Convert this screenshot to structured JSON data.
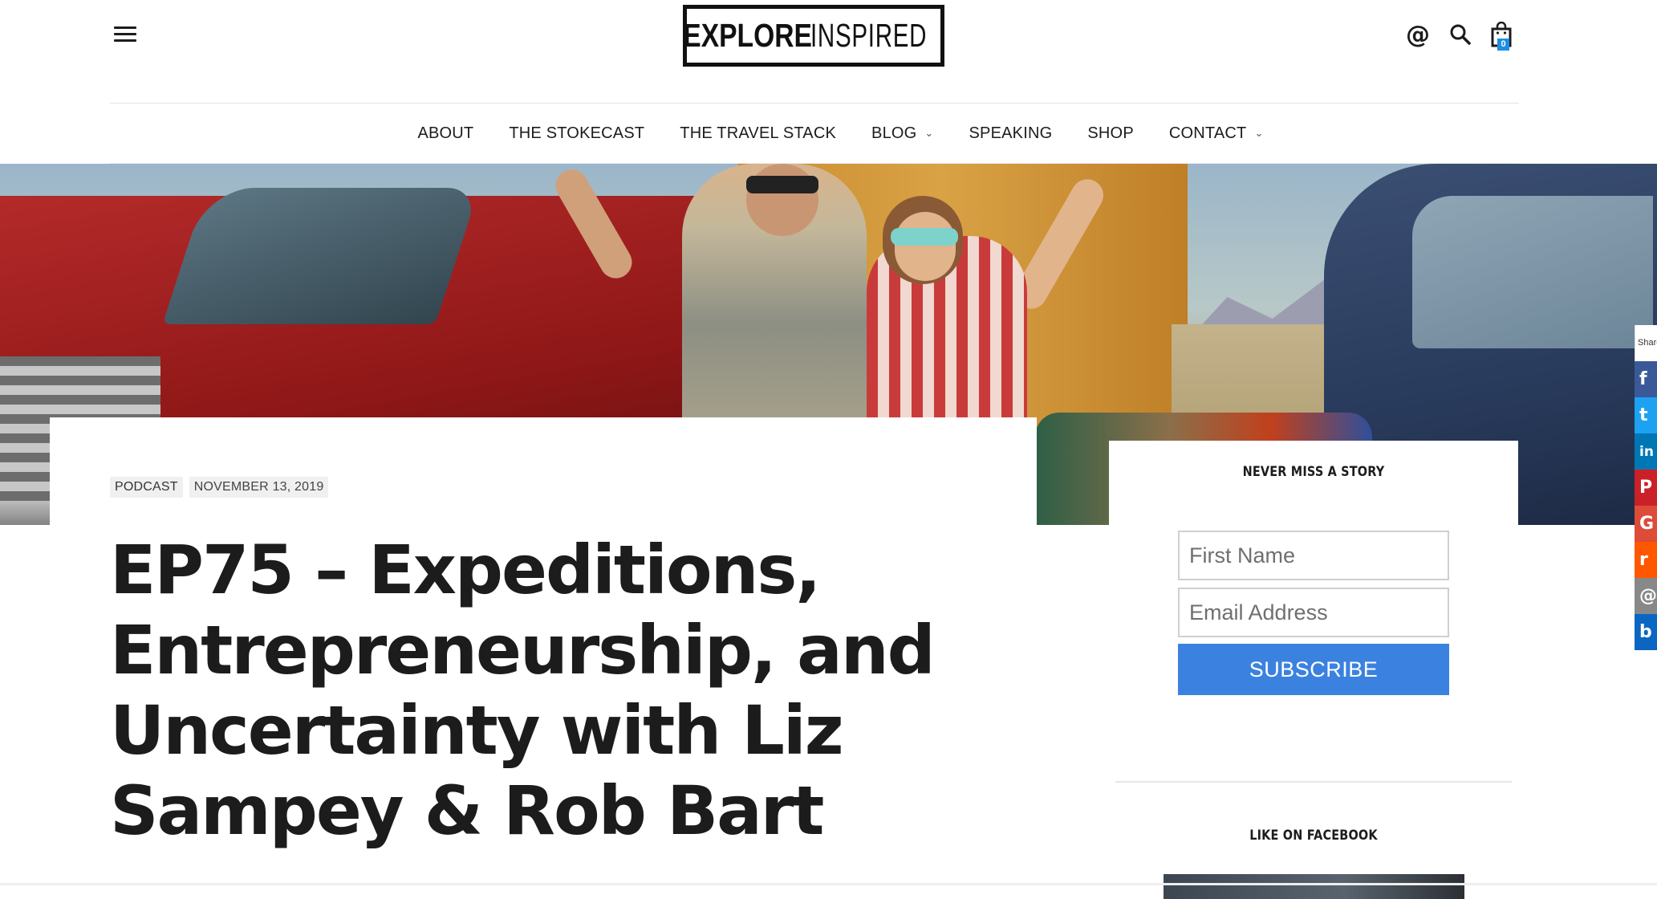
{
  "brand": {
    "logo_bold": "EXPLORE",
    "logo_light": "INSPIRED"
  },
  "header": {
    "cart_count": "0",
    "icons": [
      "menu-icon",
      "at-icon",
      "search-icon",
      "shopping-bag-icon"
    ]
  },
  "nav": {
    "items": [
      {
        "label": "ABOUT",
        "has_dropdown": false
      },
      {
        "label": "THE STOKECAST",
        "has_dropdown": false
      },
      {
        "label": "THE TRAVEL STACK",
        "has_dropdown": false
      },
      {
        "label": "BLOG",
        "has_dropdown": true
      },
      {
        "label": "SPEAKING",
        "has_dropdown": false
      },
      {
        "label": "SHOP",
        "has_dropdown": false
      },
      {
        "label": "CONTACT",
        "has_dropdown": true
      }
    ]
  },
  "article": {
    "category": "PODCAST",
    "date": "NOVEMBER 13, 2019",
    "title": "EP75 – Expeditions, Entrepreneurship, and Uncertainty with Liz Sampey & Rob Bart"
  },
  "sidebar": {
    "newsletter_title": "NEVER MISS A STORY",
    "first_name_placeholder": "First Name",
    "email_placeholder": "Email Address",
    "subscribe_label": "SUBSCRIBE",
    "facebook_title": "LIKE ON FACEBOOK"
  },
  "share": {
    "label": "Share",
    "buttons": [
      {
        "name": "facebook",
        "glyph": "f",
        "color": "#3b5998"
      },
      {
        "name": "twitter",
        "glyph": "t",
        "color": "#1da1f2"
      },
      {
        "name": "linkedin",
        "glyph": "in",
        "color": "#0077b5"
      },
      {
        "name": "pinterest",
        "glyph": "P",
        "color": "#cb2027"
      },
      {
        "name": "google",
        "glyph": "G",
        "color": "#dd4b39"
      },
      {
        "name": "reddit",
        "glyph": "r",
        "color": "#ff5700"
      },
      {
        "name": "email",
        "glyph": "@",
        "color": "#888888"
      },
      {
        "name": "bluesky",
        "glyph": "b",
        "color": "#0a66c2"
      }
    ]
  },
  "colors": {
    "accent": "#3b82e0",
    "cart_badge": "#1d8fe0",
    "text": "#1c1c1c"
  }
}
